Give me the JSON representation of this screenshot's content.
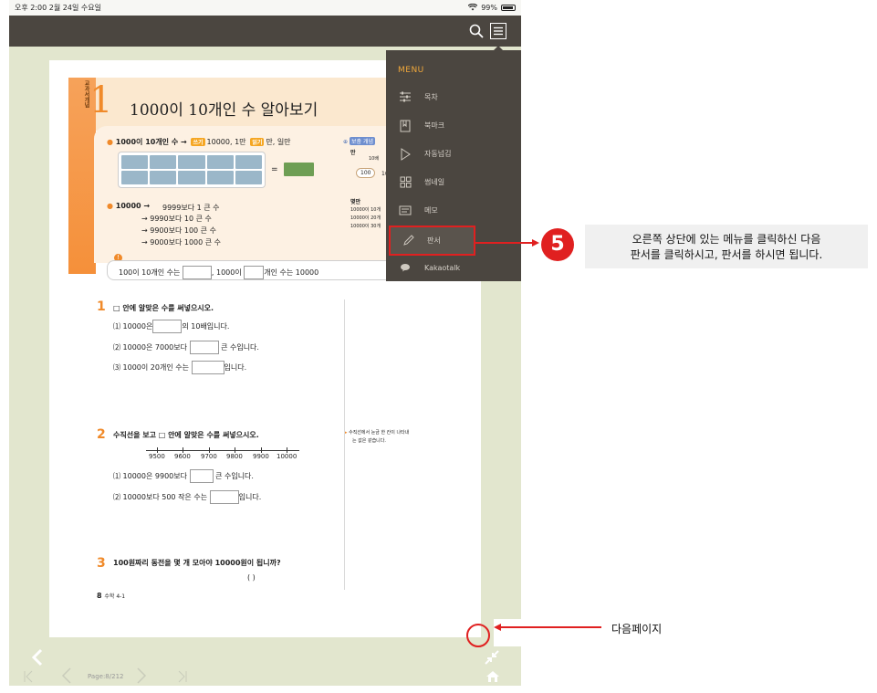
{
  "status_bar": {
    "time_date": "오후 2:00   2월 24일 수요일",
    "battery": "99%"
  },
  "top_bar": {
    "search_icon": "search-icon",
    "menu_icon": "hamburger-icon"
  },
  "page": {
    "side_label": "교과서개념",
    "lesson_number": "1",
    "title": "1000이 10개인 수 알아보기",
    "concept_line1_label": "1000이 10개인 수 →",
    "concept_line1_tag_write": "쓰기",
    "concept_line1_write": "10000, 1만",
    "concept_line1_tag_read": "읽기",
    "concept_line1_read": "만, 일만",
    "equals": "=",
    "extra_tag": "보충 개념",
    "extra_title": "만",
    "extra_10": "10배",
    "extra_100": "100",
    "extra_right": "1(",
    "extra_heading2": "몇만",
    "extra_line1": "10000이 10개",
    "extra_line2": "10000이 20개",
    "extra_line3": "10000이 30개",
    "concept_line2_label": "10000 →",
    "concept_line2_a": "9999보다 1 큰 수",
    "concept_line2_b": "→   9990보다 10 큰 수",
    "concept_line2_c": "→   9900보다 100 큰 수",
    "concept_line2_d": "→ 9000보다 1000 큰 수",
    "sentence_part1": "100이 10개인 수는",
    "sentence_part2": ", 1000이",
    "sentence_part3": "개인 수는 10000",
    "q1_num": "1",
    "q1_text": "□ 안에 알맞은 수를 써넣으시오.",
    "q1_a_pre": "⑴ 10000은",
    "q1_a_post": "의 10배입니다.",
    "q1_b_pre": "⑵ 10000은 7000보다",
    "q1_b_post": "큰 수입니다.",
    "q1_c_pre": "⑶ 1000이 20개인 수는",
    "q1_c_post": "입니다.",
    "q2_num": "2",
    "q2_text": "수직선을 보고 □ 안에 알맞은 수를 써넣으시오.",
    "numline_ticks": [
      "9500",
      "9600",
      "9700",
      "9800",
      "9900",
      "10000"
    ],
    "q2_a_pre": "⑴ 10000은 9900보다",
    "q2_a_post": "큰 수입니다.",
    "q2_b_pre": "⑵ 10000보다 500 작은 수는",
    "q2_b_post": "입니다.",
    "hint_text_1": "수직선에서 눈금 한 칸이 나타내",
    "hint_text_2": "는 값은 같습니다.",
    "q3_num": "3",
    "q3_text": "100원짜리 동전을 몇 개 모아야 10000원이 됩니까?",
    "q3_paren": "(                           )",
    "page_footer_num": "8",
    "page_footer_label": "수학 4-1"
  },
  "menu": {
    "title": "MENU",
    "items": [
      {
        "label": "목차",
        "icon": "sliders-icon"
      },
      {
        "label": "북마크",
        "icon": "bookmark-icon"
      },
      {
        "label": "자동넘김",
        "icon": "play-icon"
      },
      {
        "label": "썸네일",
        "icon": "grid-icon"
      },
      {
        "label": "메모",
        "icon": "memo-icon"
      },
      {
        "label": "판서",
        "icon": "pen-icon"
      },
      {
        "label": "Kakaotalk",
        "icon": "chat-icon"
      }
    ]
  },
  "bottom_nav": {
    "page_indicator": "Page:8/212"
  },
  "annotation": {
    "step_number": "5",
    "note_line1": "오른쪽 상단에 있는 메뉴를 클릭하신 다음",
    "note_line2": "판서를 클릭하시고, 판서를 하시면 됩니다.",
    "next_page_label": "다음페이지"
  },
  "colors": {
    "accent_orange": "#f08a2a",
    "menu_bg": "#4b4640",
    "annotation_red": "#e02020",
    "reader_bg": "#e2e6ce"
  }
}
